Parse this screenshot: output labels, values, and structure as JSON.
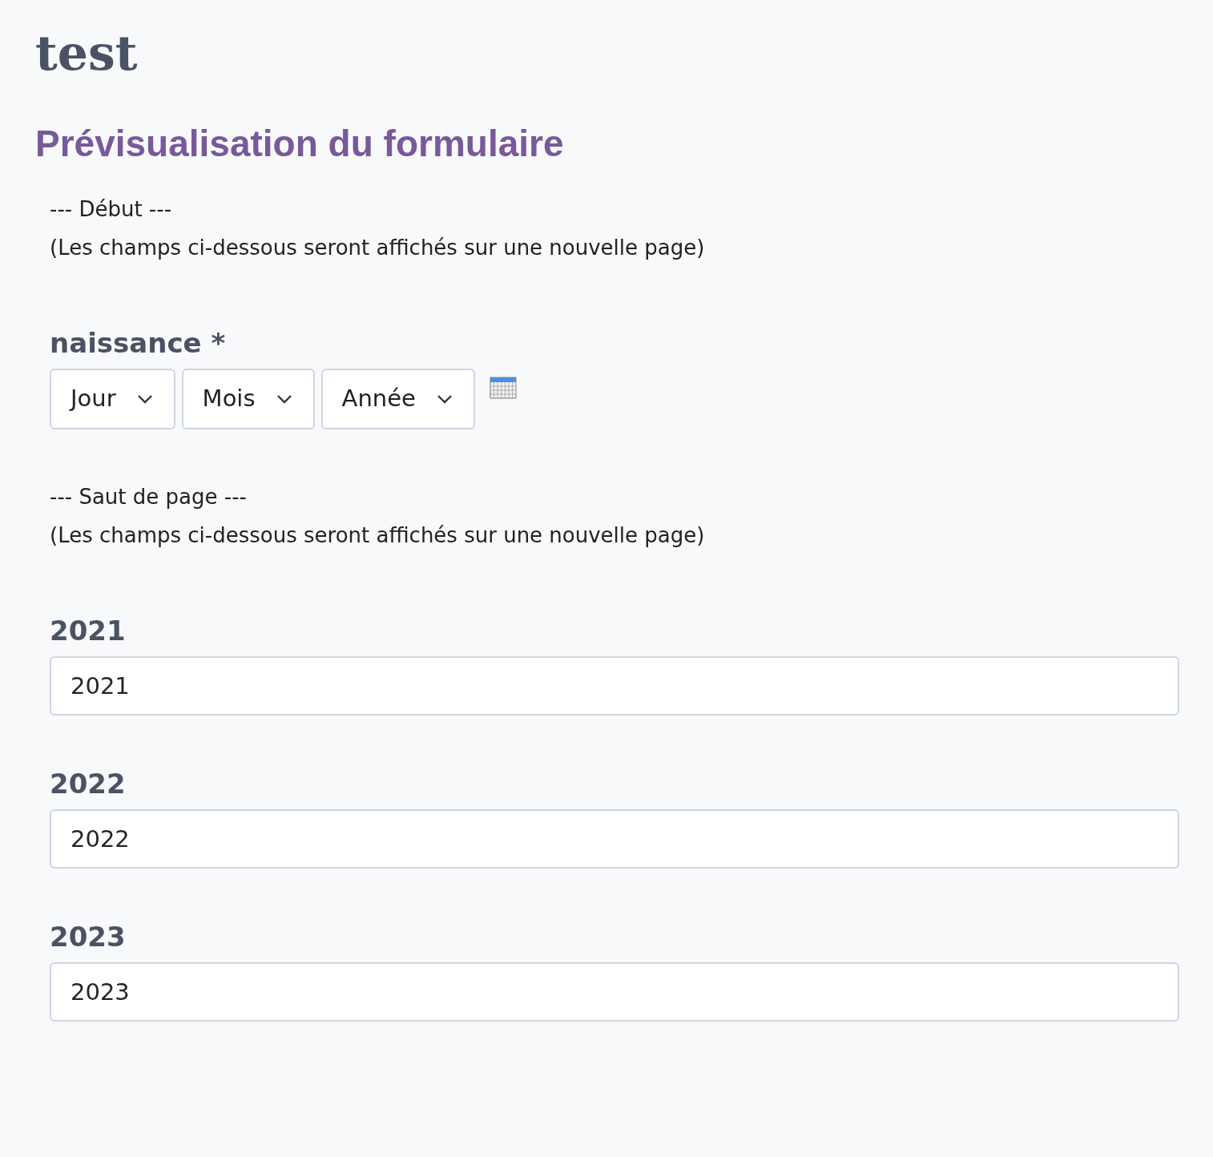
{
  "page_title": "test",
  "form_heading": "Prévisualisation du formulaire",
  "sections": [
    {
      "kind": "pagebreak",
      "marker": "--- Début ---",
      "note": "(Les champs ci-dessous seront affichés sur une nouvelle page)"
    },
    {
      "kind": "date",
      "label": "naissance *",
      "selects": [
        "Jour",
        "Mois",
        "Année"
      ]
    },
    {
      "kind": "pagebreak",
      "marker": "--- Saut de page ---",
      "note": "(Les champs ci-dessous seront affichés sur une nouvelle page)"
    },
    {
      "kind": "text",
      "label": "2021",
      "value": "2021"
    },
    {
      "kind": "text",
      "label": "2022",
      "value": "2022"
    },
    {
      "kind": "text",
      "label": "2023",
      "value": "2023"
    }
  ]
}
